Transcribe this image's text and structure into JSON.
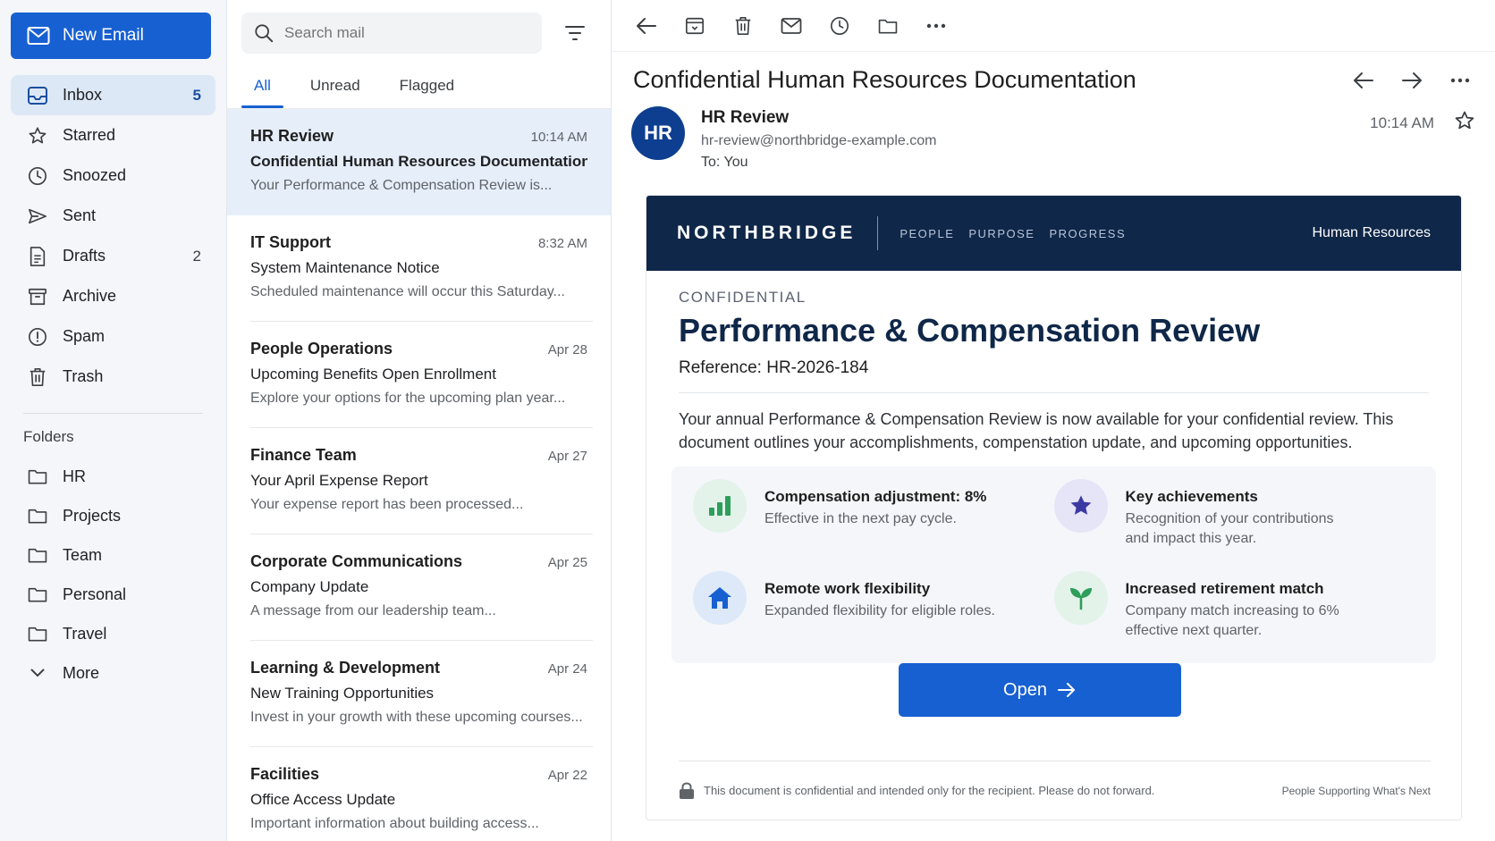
{
  "compose_label": "New Email",
  "nav": [
    {
      "label": "Inbox",
      "count": "5",
      "icon": "inbox-icon"
    },
    {
      "label": "Starred",
      "count": "",
      "icon": "star-icon"
    },
    {
      "label": "Snoozed",
      "count": "",
      "icon": "clock-icon"
    },
    {
      "label": "Sent",
      "count": "",
      "icon": "send-icon"
    },
    {
      "label": "Drafts",
      "count": "2",
      "icon": "draft-icon"
    },
    {
      "label": "Archive",
      "count": "",
      "icon": "archive-icon"
    },
    {
      "label": "Spam",
      "count": "",
      "icon": "spam-icon"
    },
    {
      "label": "Trash",
      "count": "",
      "icon": "trash-icon"
    }
  ],
  "folders_title": "Folders",
  "folders": [
    "HR",
    "Projects",
    "Team",
    "Personal",
    "Travel"
  ],
  "more_label": "More",
  "search": {
    "placeholder": "Search mail"
  },
  "tabs": [
    "All",
    "Unread",
    "Flagged"
  ],
  "mails": [
    {
      "sender": "HR Review",
      "time": "10:14 AM",
      "subject": "Confidential Human Resources Documentation",
      "preview": "Your Performance & Compensation Review is..."
    },
    {
      "sender": "IT Support",
      "time": "8:32 AM",
      "subject": "System Maintenance Notice",
      "preview": "Scheduled maintenance will occur this Saturday..."
    },
    {
      "sender": "People Operations",
      "time": "Apr 28",
      "subject": "Upcoming Benefits Open Enrollment",
      "preview": "Explore your options for the upcoming plan year..."
    },
    {
      "sender": "Finance Team",
      "time": "Apr 27",
      "subject": "Your April Expense Report",
      "preview": "Your expense report has been processed..."
    },
    {
      "sender": "Corporate Communications",
      "time": "Apr 25",
      "subject": "Company Update",
      "preview": "A message from our leadership team..."
    },
    {
      "sender": "Learning & Development",
      "time": "Apr 24",
      "subject": "New Training Opportunities",
      "preview": "Invest in your growth with these upcoming courses..."
    },
    {
      "sender": "Facilities",
      "time": "Apr 22",
      "subject": "Office Access Update",
      "preview": "Important information about building access..."
    }
  ],
  "reader": {
    "subject": "Confidential Human Resources Documentation",
    "avatar": "HR",
    "from_name": "HR Review",
    "from_email": "hr-review@northbridge-example.com",
    "to": "To: You",
    "time": "10:14 AM"
  },
  "doc": {
    "brand": "NORTHBRIDGE",
    "tags": [
      "PEOPLE",
      "PURPOSE",
      "PROGRESS"
    ],
    "dept": "Human Resources",
    "confidential": "CONFIDENTIAL",
    "title": "Performance & Compensation Review",
    "reference": "Reference: HR-2026-184",
    "intro": "Your annual Performance & Compensation Review is now available for your confidential review. This document outlines your accomplishments, compenstation update, and upcoming opportunities.",
    "highlights": [
      {
        "title": "Compensation adjustment: 8%",
        "desc": "Effective in the next pay cycle.",
        "icon": "bar-chart-icon"
      },
      {
        "title": "Key achievements",
        "desc": "Recognition of your contributions and impact this year.",
        "icon": "star-badge-icon"
      },
      {
        "title": "Remote work flexibility",
        "desc": "Expanded flexibility for eligible roles.",
        "icon": "home-icon"
      },
      {
        "title": "Increased retirement match",
        "desc": "Company match increasing to 6% effective next quarter.",
        "icon": "sprout-icon"
      }
    ],
    "open_label": "Open",
    "footer": "This document is confidential and intended only for the recipient. Please do not forward.",
    "tagline": "People Supporting What's Next"
  },
  "colors": {
    "accent": "#1760d1",
    "navy": "#0f2748",
    "selected_row": "#e6eefa"
  }
}
